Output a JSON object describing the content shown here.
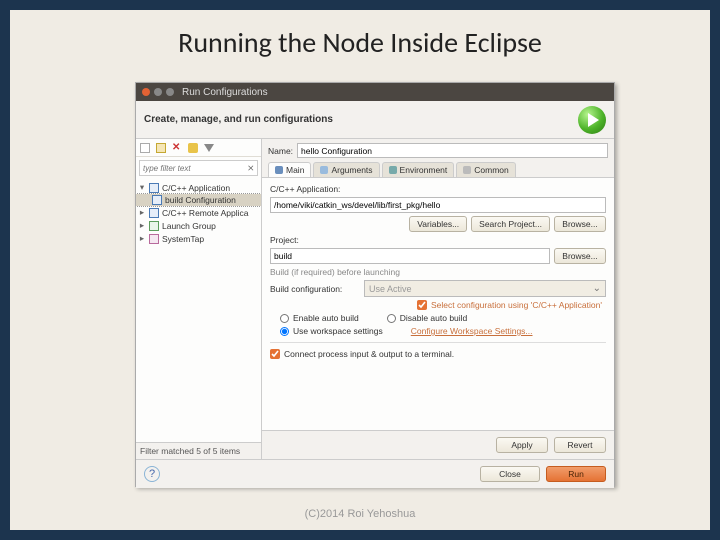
{
  "slide": {
    "title": "Running the Node Inside Eclipse",
    "copyright": "(C)2014 Roi Yehoshua"
  },
  "window": {
    "title": "Run Configurations",
    "header": "Create, manage, and run configurations"
  },
  "left": {
    "filter_placeholder": "type filter text",
    "filter_clear": "⨯",
    "nodes": [
      {
        "label": "C/C++ Application",
        "expanded": true
      },
      {
        "label": "build Configuration",
        "child": true,
        "selected": true
      },
      {
        "label": "C/C++ Remote Applica",
        "expanded": false
      },
      {
        "label": "Launch Group",
        "expanded": false
      },
      {
        "label": "SystemTap",
        "expanded": false
      }
    ],
    "footer": "Filter matched 5 of 5 items"
  },
  "right": {
    "name_label": "Name:",
    "name_value": "hello Configuration",
    "tabs": [
      {
        "label": "Main",
        "active": true
      },
      {
        "label": "Arguments",
        "active": false
      },
      {
        "label": "Environment",
        "active": false
      },
      {
        "label": "Common",
        "active": false
      }
    ],
    "app_label": "C/C++ Application:",
    "app_value": "/home/viki/catkin_ws/devel/lib/first_pkg/hello",
    "btn_variables": "Variables...",
    "btn_search": "Search Project...",
    "btn_browse": "Browse...",
    "project_label": "Project:",
    "project_value": "build",
    "before_launch": "Build (if required) before launching",
    "build_cfg_label": "Build configuration:",
    "build_cfg_value": "Use Active",
    "chk_select_cfg": "Select configuration using 'C/C++ Application'",
    "radio_enable": "Enable auto build",
    "radio_disable": "Disable auto build",
    "radio_workspace": "Use workspace settings",
    "link_workspace": "Configure Workspace Settings...",
    "chk_terminal": "Connect process input & output to a terminal.",
    "btn_apply": "Apply",
    "btn_revert": "Revert",
    "btn_close": "Close",
    "btn_run": "Run"
  }
}
